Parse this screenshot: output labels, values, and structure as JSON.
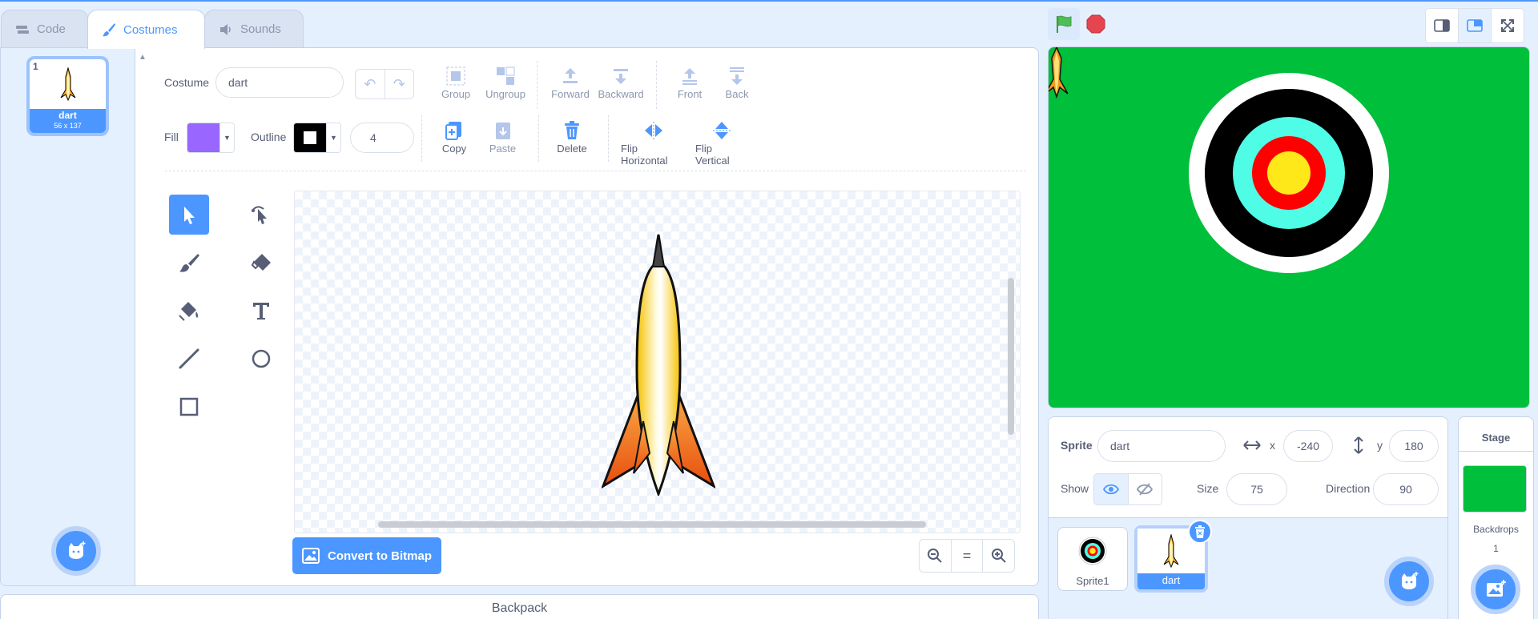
{
  "tabs": [
    {
      "label": "Code",
      "icon": "code-icon"
    },
    {
      "label": "Costumes",
      "icon": "brush-icon"
    },
    {
      "label": "Sounds",
      "icon": "speaker-icon"
    }
  ],
  "costume_list": {
    "items": [
      {
        "number": "1",
        "name": "dart",
        "size": "56 x 137"
      }
    ]
  },
  "paint_editor": {
    "costume_label": "Costume",
    "costume_name": "dart",
    "toolbar1": {
      "group": "Group",
      "ungroup": "Ungroup",
      "forward": "Forward",
      "backward": "Backward",
      "front": "Front",
      "back": "Back"
    },
    "fill_label": "Fill",
    "fill_color": "#9966ff",
    "outline_label": "Outline",
    "outline_color": "#000000",
    "outline_width": "4",
    "toolbar2": {
      "copy": "Copy",
      "paste": "Paste",
      "delete": "Delete",
      "flip_horizontal": "Flip Horizontal",
      "flip_vertical": "Flip Vertical"
    },
    "tools": [
      "select-tool",
      "reshape-tool",
      "brush-tool",
      "eraser-tool",
      "fill-tool",
      "text-tool",
      "line-tool",
      "circle-tool",
      "rectangle-tool"
    ],
    "convert_label": "Convert to Bitmap",
    "zoom": {
      "out": "zoom-out-icon",
      "reset": "=",
      "in": "zoom-in-icon"
    }
  },
  "backpack": {
    "label": "Backpack"
  },
  "sprite_info": {
    "sprite_label": "Sprite",
    "sprite_name": "dart",
    "x_label": "x",
    "x_value": "-240",
    "y_label": "y",
    "y_value": "180",
    "show_label": "Show",
    "size_label": "Size",
    "size_value": "75",
    "direction_label": "Direction",
    "direction_value": "90"
  },
  "sprites": [
    {
      "name": "Sprite1",
      "selected": false
    },
    {
      "name": "dart",
      "selected": true
    }
  ],
  "stage_pane": {
    "label": "Stage",
    "backdrops_label": "Backdrops",
    "backdrops_count": "1",
    "stage_color": "#00bf3b"
  },
  "colors": {
    "accent": "#4c97ff",
    "stop": "#e6454f",
    "flag": "#4cbf56"
  }
}
